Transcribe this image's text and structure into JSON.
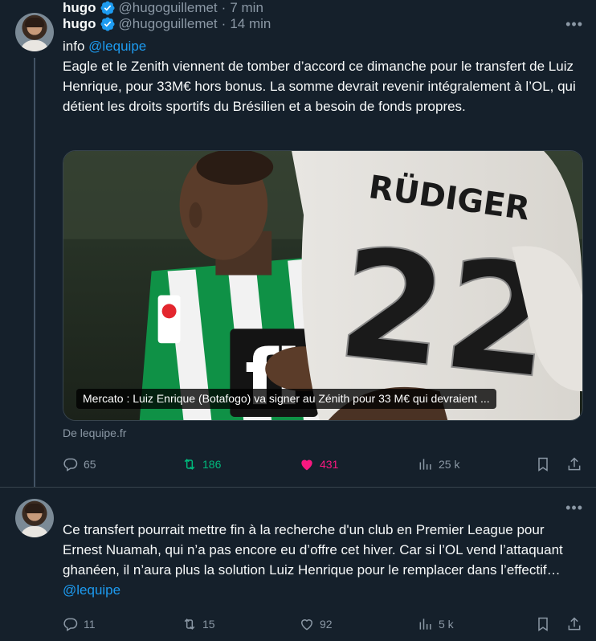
{
  "tweets": [
    {
      "author_name": "hugo",
      "handle": "@hugoguillemet",
      "separator": "·",
      "time": "14 min",
      "text_prefix": "info ",
      "mention": "@lequipe",
      "text_body": "Eagle et le Zenith viennent de tomber d’accord ce dimanche pour le transfert de Luiz Henrique, pour 33M€ hors bonus. La somme devrait revenir intégralement à l’OL, qui détient les droits sportifs du Brésilien et a besoin de fonds propres.",
      "card": {
        "caption": "Mercato : Luiz Enrique (Botafogo) va signer au Zénith pour 33 M€ qui devraient ...",
        "source": "De lequipe.fr",
        "jersey_name": "RÜDIGER",
        "jersey_number": "22",
        "sponsor_letters": "fi"
      },
      "stats": {
        "replies": "65",
        "reposts": "186",
        "likes": "431",
        "views": "25 k"
      },
      "liked": true,
      "reposted": true
    },
    {
      "author_name": "hugo",
      "handle": "@hugoguillemet",
      "separator": "·",
      "time": "7 min",
      "text_body": "Ce transfert pourrait mettre fin à la recherche d'un club en Premier League pour Ernest Nuamah, qui n’a pas encore eu d’offre cet hiver. Car si l’OL vend l’attaquant ghanéen, il n’aura plus la solution Luiz Henrique pour le remplacer dans l’effectif… ",
      "mention": "@lequipe",
      "stats": {
        "replies": "11",
        "reposts": "15",
        "likes": "92",
        "views": "5 k"
      },
      "liked": false,
      "reposted": false
    }
  ],
  "colors": {
    "background": "#15202b",
    "text": "#f7f9f9",
    "muted": "#8b98a5",
    "accent": "#1d9bf0",
    "repost_active": "#00ba7c",
    "like_active": "#f91880",
    "divider": "#38444d"
  },
  "icons": [
    "verified-icon",
    "more-icon",
    "reply-icon",
    "repost-icon",
    "like-icon",
    "views-icon",
    "bookmark-icon",
    "share-icon"
  ]
}
